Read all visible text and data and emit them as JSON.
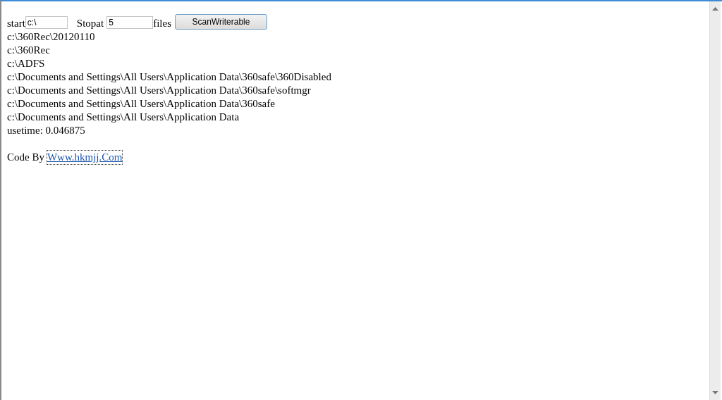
{
  "form": {
    "start_label": "start",
    "start_value": "c:\\",
    "stop_label": "Stopat",
    "stop_value": "5",
    "files_label": "files",
    "button": "ScanWriterable"
  },
  "results": [
    "c:\\360Rec\\20120110",
    "c:\\360Rec",
    "c:\\ADFS",
    "c:\\Documents and Settings\\All Users\\Application Data\\360safe\\360Disabled",
    "c:\\Documents and Settings\\All Users\\Application Data\\360safe\\softmgr",
    "c:\\Documents and Settings\\All Users\\Application Data\\360safe",
    "c:\\Documents and Settings\\All Users\\Application Data"
  ],
  "usetime": "usetime: 0.046875",
  "footer": {
    "label": "Code By",
    "link": "Www.hkmjj.Com"
  }
}
